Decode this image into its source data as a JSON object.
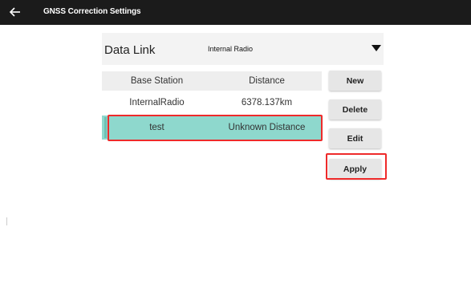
{
  "app_bar": {
    "title": "GNSS Correction Settings",
    "back_icon": "arrow-left-icon"
  },
  "data_link": {
    "label": "Data Link",
    "value": "Internal Radio",
    "dropdown_icon": "caret-down-icon"
  },
  "table": {
    "columns": [
      "Base Station",
      "Distance"
    ],
    "rows": [
      {
        "base_station": "InternalRadio",
        "distance": "6378.137km",
        "selected": false
      },
      {
        "base_station": "test",
        "distance": "Unknown Distance",
        "selected": true
      }
    ]
  },
  "buttons": {
    "new": "New",
    "delete": "Delete",
    "edit": "Edit",
    "apply": "Apply"
  },
  "colors": {
    "app_bar": "#1b1b1b",
    "selected_row": "#8ed8cd",
    "highlight_outline": "#ee2a2a",
    "button": "#e6e6e6"
  }
}
